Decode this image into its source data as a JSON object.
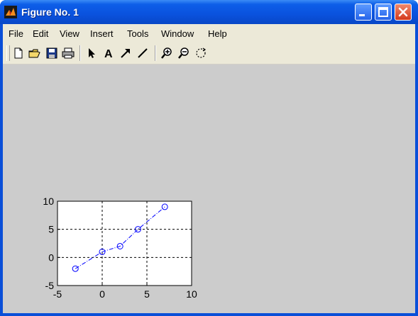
{
  "window": {
    "title": "Figure No. 1"
  },
  "menu": {
    "items": [
      "File",
      "Edit",
      "View",
      "Insert",
      "Tools",
      "Window",
      "Help"
    ]
  },
  "toolbar": {
    "tools": [
      "new-file-icon",
      "open-folder-icon",
      "save-icon",
      "print-icon",
      "select-arrow-icon",
      "insert-text-icon",
      "insert-arrow-icon",
      "insert-line-icon",
      "zoom-in-icon",
      "zoom-out-icon",
      "rotate-3d-icon"
    ]
  },
  "colors": {
    "titlebar": "#0a52de",
    "menubar": "#ece9d8",
    "canvas": "#cccccc",
    "series": "#0000ff"
  },
  "chart_data": {
    "type": "line",
    "title": "",
    "xlabel": "",
    "ylabel": "",
    "xlim": [
      -5,
      10
    ],
    "ylim": [
      -5,
      10
    ],
    "xticks": [
      -5,
      0,
      5,
      10
    ],
    "yticks": [
      -5,
      0,
      5,
      10
    ],
    "grid": true,
    "series": [
      {
        "marker": "circle",
        "line_style": "dash-dot",
        "color": "#0000ff",
        "x": [
          -3,
          0,
          2,
          4,
          7
        ],
        "y": [
          -2,
          1,
          2,
          5,
          9
        ]
      }
    ]
  }
}
